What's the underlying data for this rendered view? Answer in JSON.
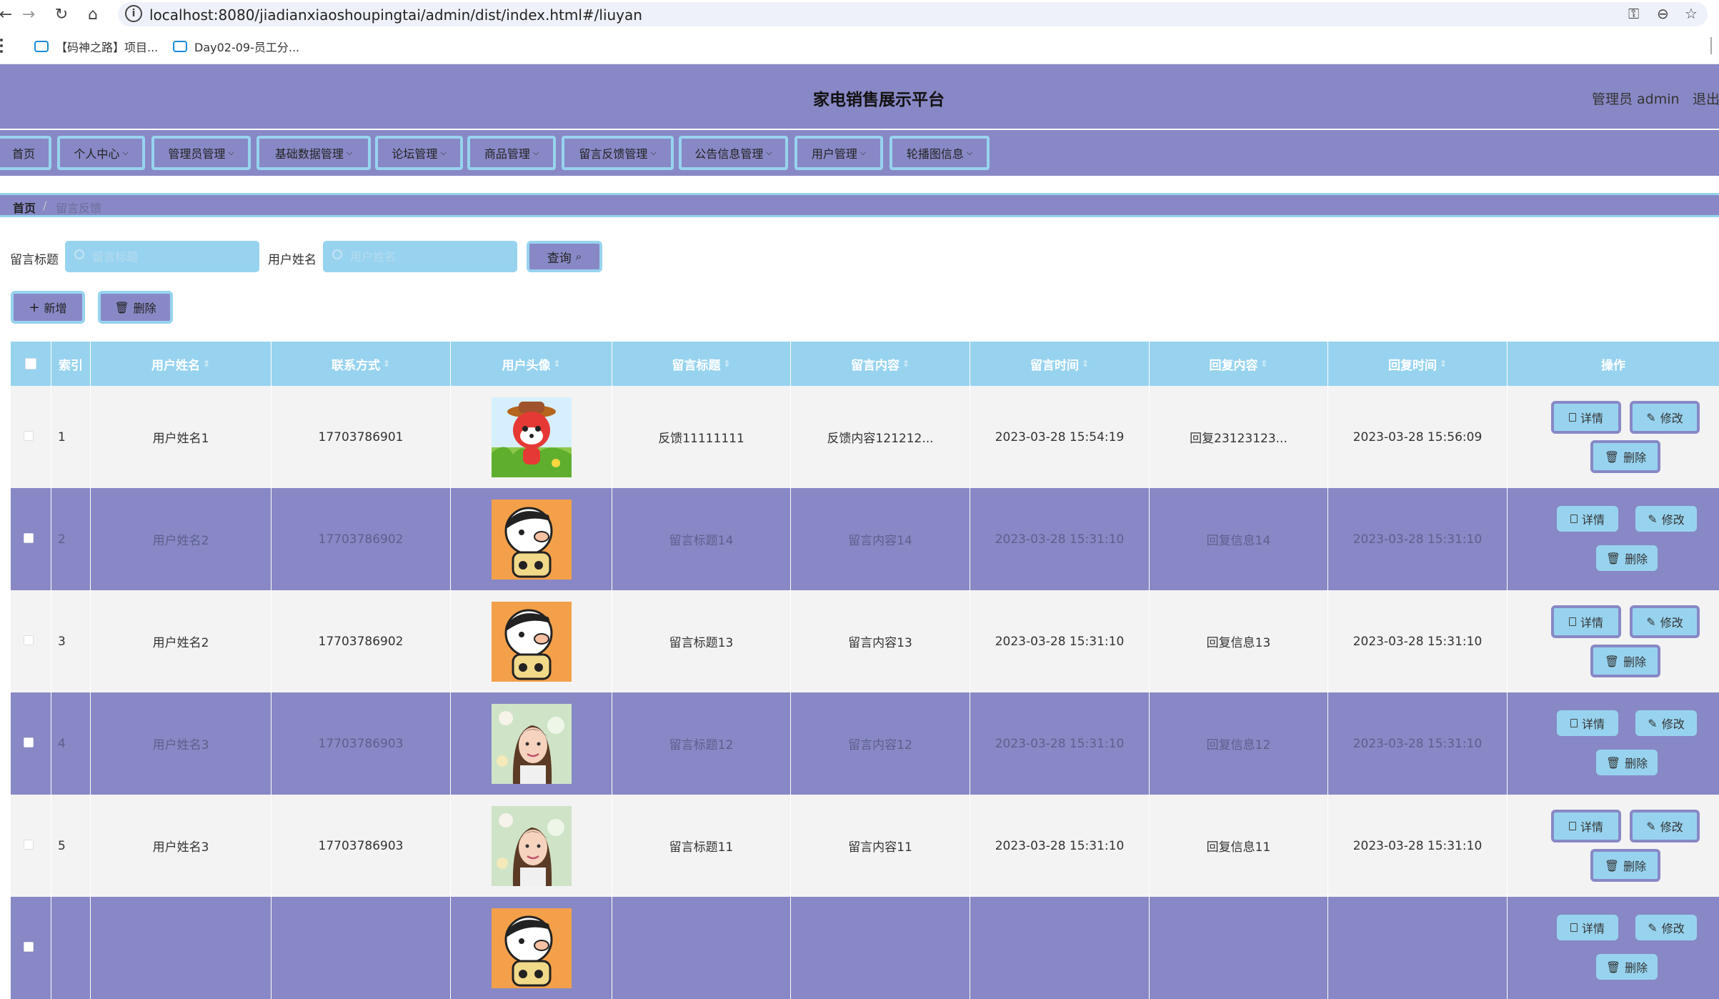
{
  "browser": {
    "url": "localhost:8080/jiadianxiaoshoupingtai/admin/dist/index.html#/liuyan",
    "bookmarks": [
      "【码神之路】项目...",
      "Day02-09-员工分..."
    ]
  },
  "header": {
    "title": "家电销售展示平台",
    "user": "管理员 admin",
    "logout": "退出"
  },
  "menu": [
    {
      "label": "首页"
    },
    {
      "label": "个人中心"
    },
    {
      "label": "管理员管理"
    },
    {
      "label": "基础数据管理"
    },
    {
      "label": "论坛管理"
    },
    {
      "label": "商品管理"
    },
    {
      "label": "留言反馈管理"
    },
    {
      "label": "公告信息管理"
    },
    {
      "label": "用户管理"
    },
    {
      "label": "轮播图信息"
    }
  ],
  "breadcrumb": {
    "home": "首页",
    "separator": "/",
    "current": "留言反馈"
  },
  "search": {
    "title_label": "留言标题",
    "title_placeholder": "留言标题",
    "name_label": "用户姓名",
    "name_placeholder": "用户姓名",
    "query_label": "查询"
  },
  "actions": {
    "add_label": "新增",
    "delete_label": "删除"
  },
  "table": {
    "headers": [
      "索引",
      "用户姓名",
      "联系方式",
      "用户头像",
      "留言标题",
      "留言内容",
      "留言时间",
      "回复内容",
      "回复时间",
      "操作"
    ],
    "row_actions": {
      "detail": "详情",
      "edit": "修改",
      "delete": "删除"
    },
    "rows": [
      {
        "index": "1",
        "name": "用户姓名1",
        "phone": "17703786901",
        "avatar": "cartoon-fox-avatar",
        "title": "反馈11111111",
        "content": "反馈内容121212...",
        "time": "2023-03-28 15:54:19",
        "reply": "回复23123123...",
        "reply_time": "2023-03-28 15:56:09"
      },
      {
        "index": "2",
        "name": "用户姓名2",
        "phone": "17703786902",
        "avatar": "cartoon-boy-avatar",
        "title": "留言标题14",
        "content": "留言内容14",
        "time": "2023-03-28 15:31:10",
        "reply": "回复信息14",
        "reply_time": "2023-03-28 15:31:10"
      },
      {
        "index": "3",
        "name": "用户姓名2",
        "phone": "17703786902",
        "avatar": "cartoon-boy-avatar",
        "title": "留言标题13",
        "content": "留言内容13",
        "time": "2023-03-28 15:31:10",
        "reply": "回复信息13",
        "reply_time": "2023-03-28 15:31:10"
      },
      {
        "index": "4",
        "name": "用户姓名3",
        "phone": "17703786903",
        "avatar": "woman-photo-avatar",
        "title": "留言标题12",
        "content": "留言内容12",
        "time": "2023-03-28 15:31:10",
        "reply": "回复信息12",
        "reply_time": "2023-03-28 15:31:10"
      },
      {
        "index": "5",
        "name": "用户姓名3",
        "phone": "17703786903",
        "avatar": "woman-photo-avatar",
        "title": "留言标题11",
        "content": "留言内容11",
        "time": "2023-03-28 15:31:10",
        "reply": "回复信息11",
        "reply_time": "2023-03-28 15:31:10"
      },
      {
        "index": "",
        "name": "",
        "phone": "",
        "avatar": "cartoon-boy-avatar",
        "title": "",
        "content": "",
        "time": "",
        "reply": "",
        "reply_time": ""
      }
    ]
  },
  "colors": {
    "primary": "#8888c6",
    "accent": "#97d3ef",
    "row_light": "#f3f3f3"
  }
}
